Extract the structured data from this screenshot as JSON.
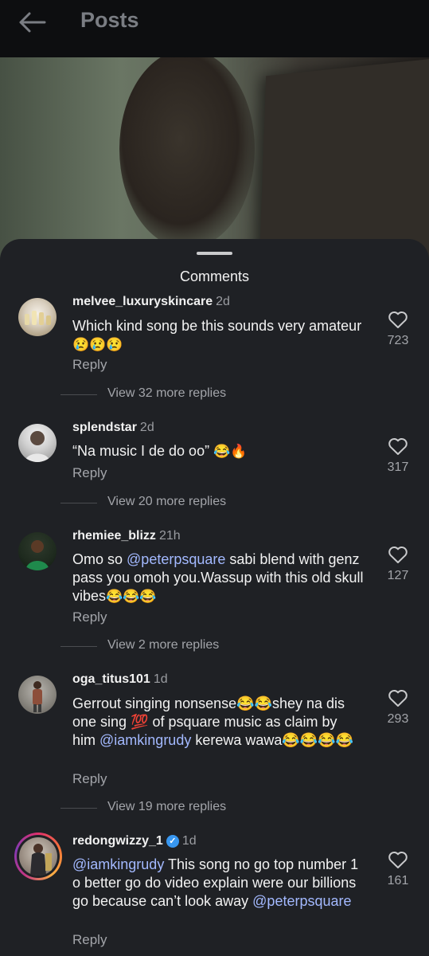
{
  "header": {
    "title": "Posts",
    "back_icon": "arrow-left-icon"
  },
  "sheet": {
    "title": "Comments"
  },
  "comments": [
    {
      "username": "melvee_luxuryskincare",
      "time": "2d",
      "text": "Which kind song be this sounds very amateur",
      "emoji": "😢😢😢",
      "reply": "Reply",
      "likes": "723",
      "view_replies": "View 32 more replies"
    },
    {
      "username": "splendstar",
      "time": "2d",
      "text": "“Na music I de do oo”",
      "emoji": "😂🔥",
      "reply": "Reply",
      "likes": "317",
      "view_replies": "View 20 more replies"
    },
    {
      "username": "rhemiee_blizz",
      "time": "21h",
      "text_before": "Omo so ",
      "mention": "@peterpsquare",
      "text_after": " sabi blend with genz pass you omoh you.Wassup with this old skull vibes",
      "emoji": "😂😂😂",
      "reply": "Reply",
      "likes": "127",
      "view_replies": "View 2 more replies"
    },
    {
      "username": "oga_titus101",
      "time": "1d",
      "text_before": "Gerrout singing nonsense😂😂shey na dis one sing 💯 of psquare music as claim by him ",
      "mention": "@iamkingrudy",
      "text_after": "  kerewa wawa😂😂😂😂",
      "reply": "Reply",
      "likes": "293",
      "view_replies": "View 19 more replies"
    },
    {
      "username": "redongwizzy_1",
      "time": "1d",
      "mention": "@iamkingrudy",
      "text_mid": " This song no go top number 1 o better go do video explain were our billions go because can’t look away ",
      "mention2": "@peterpsquare",
      "reply": "Reply",
      "likes": "161"
    }
  ],
  "colors": {
    "background": "#1f2125",
    "topbar": "#0d0e10",
    "mention": "#a3b9ff",
    "muted": "#a3a5aa",
    "verified": "#3897f0"
  }
}
